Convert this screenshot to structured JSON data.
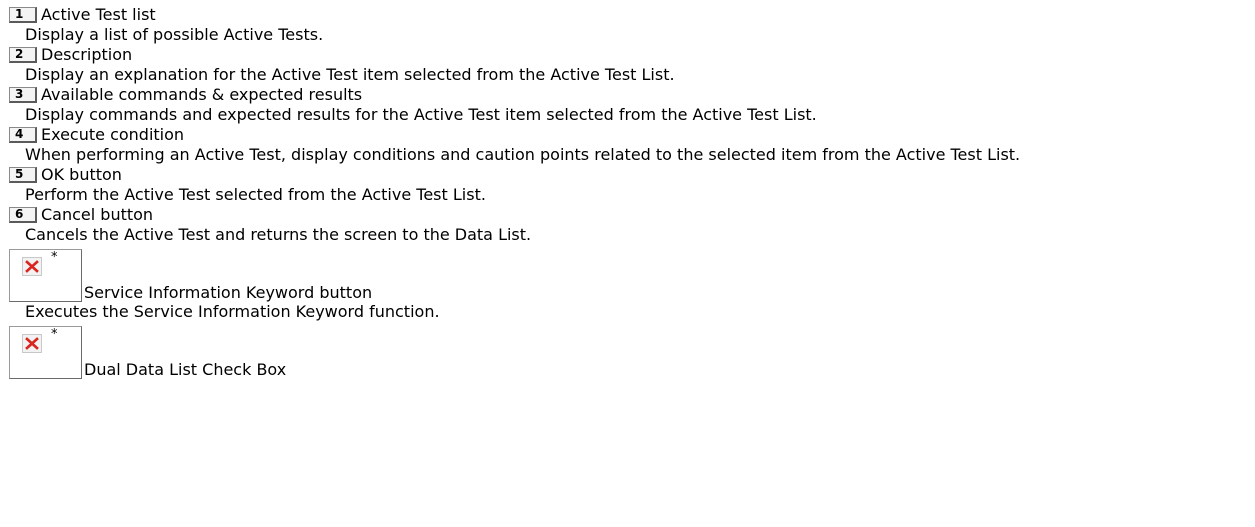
{
  "items": [
    {
      "number": "1",
      "title": "Active Test list",
      "description": "Display a list of possible Active Tests."
    },
    {
      "number": "2",
      "title": "Description",
      "description": "Display an explanation for the Active Test item selected from the Active Test List."
    },
    {
      "number": "3",
      "title": "Available commands & expected results",
      "description": "Display commands and expected results for the Active Test item selected from the Active Test List."
    },
    {
      "number": "4",
      "title": "Execute condition",
      "description": "When performing an Active Test, display conditions and caution points related to the selected item from the Active Test List."
    },
    {
      "number": "5",
      "title": "OK button",
      "description": "Perform the Active Test selected from the Active Test List."
    },
    {
      "number": "6",
      "title": "Cancel button",
      "description": "Cancels the Active Test and returns the screen to the Data List."
    }
  ],
  "image_items": [
    {
      "marker": "*",
      "icon": "broken-image-icon",
      "title": "Service Information Keyword button",
      "description": "Executes the Service Information Keyword function."
    },
    {
      "marker": "*",
      "icon": "broken-image-icon",
      "title": "Dual Data List Check Box",
      "description": ""
    }
  ]
}
